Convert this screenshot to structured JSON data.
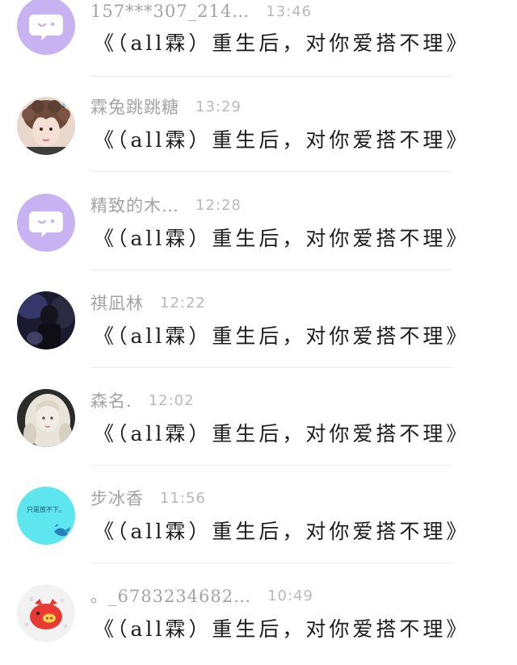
{
  "comments": [
    {
      "username": "157***307_214…",
      "time": "13:46",
      "text": "《（all霖）重生后，对你爱搭不理》",
      "avatar": "default-purple-icon"
    },
    {
      "username": "霖兔跳跳糖",
      "time": "13:29",
      "text": "《（all霖）重生后，对你爱搭不理》",
      "avatar": "curly-hair-boy-photo"
    },
    {
      "username": "精致的木…",
      "time": "12:28",
      "text": "《（all霖）重生后，对你爱搭不理》",
      "avatar": "default-purple-icon"
    },
    {
      "username": "祺凪林",
      "time": "12:22",
      "text": "《（all霖）重生后，对你爱搭不理》",
      "avatar": "dark-stage-photo"
    },
    {
      "username": "森名.",
      "time": "12:02",
      "text": "《（all霖）重生后，对你爱搭不理》",
      "avatar": "blonde-girl-photo"
    },
    {
      "username": "步冰香",
      "time": "11:56",
      "text": "《（all霖）重生后，对你爱搭不理》",
      "avatar": "cyan-text-whale-image",
      "avatar_text": "只是放不下。"
    },
    {
      "username": "。_6783234682…",
      "time": "10:49",
      "text": "《（all霖）重生后，对你爱搭不理》",
      "avatar": "red-pig-icon"
    }
  ],
  "colors": {
    "default_avatar": "#c8b3f2",
    "username": "#a3a3a3",
    "time": "#b9b9b9",
    "text": "#1c1c1c",
    "cyan_avatar": "#5ee6ef"
  }
}
